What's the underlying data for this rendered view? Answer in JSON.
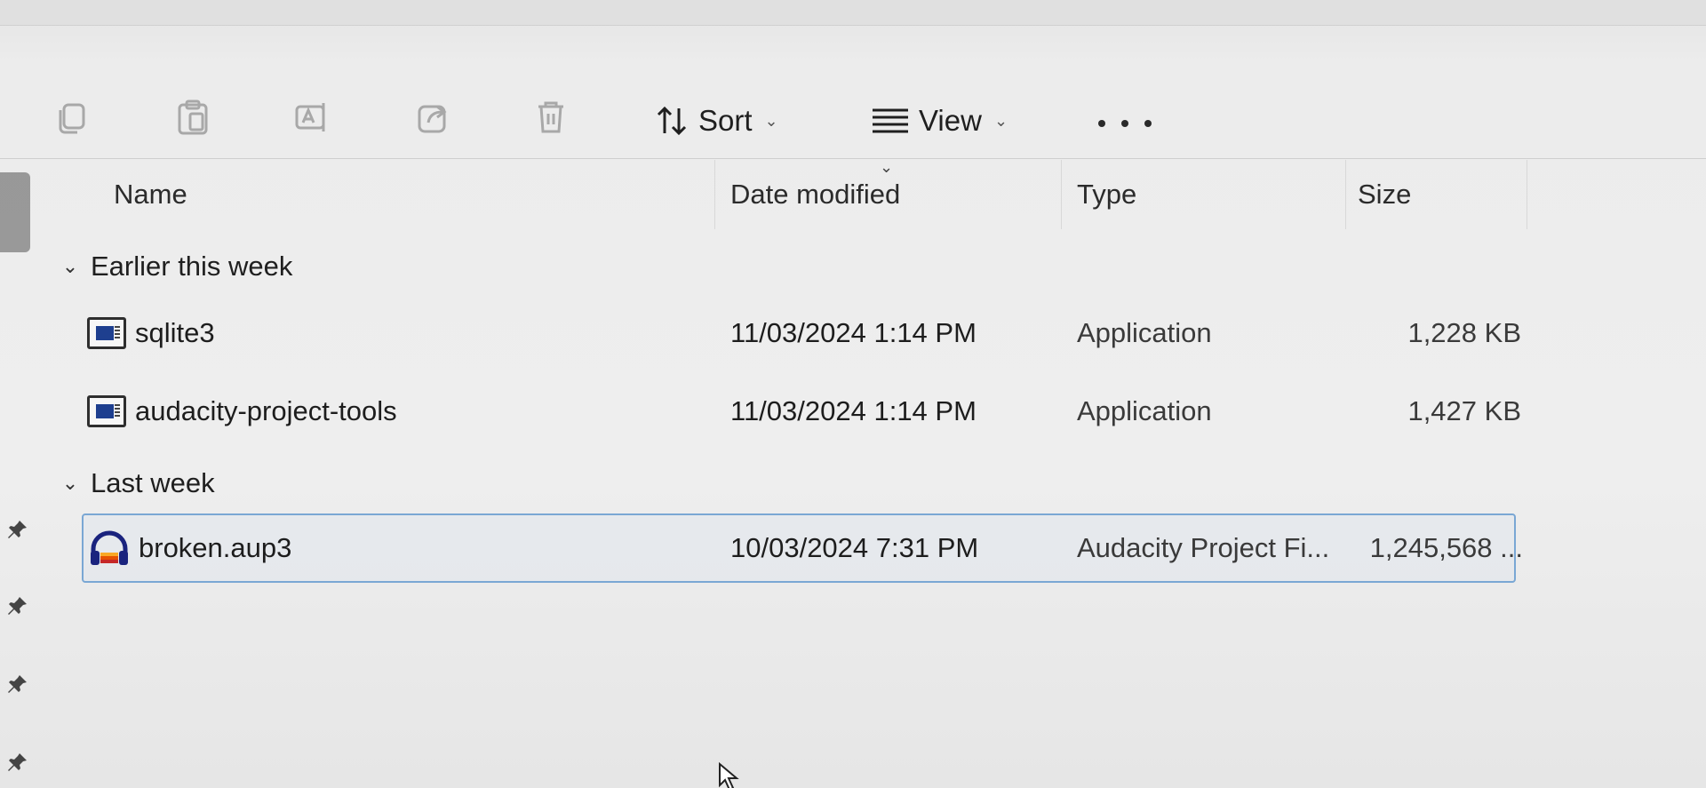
{
  "toolbar": {
    "sort_label": "Sort",
    "view_label": "View"
  },
  "columns": {
    "name": "Name",
    "date_modified": "Date modified",
    "type": "Type",
    "size": "Size"
  },
  "groups": [
    {
      "label": "Earlier this week",
      "files": [
        {
          "name": "sqlite3",
          "date": "11/03/2024 1:14 PM",
          "type": "Application",
          "size": "1,228 KB",
          "icon": "application-icon"
        },
        {
          "name": "audacity-project-tools",
          "date": "11/03/2024 1:14 PM",
          "type": "Application",
          "size": "1,427 KB",
          "icon": "application-icon"
        }
      ]
    },
    {
      "label": "Last week",
      "files": [
        {
          "name": "broken.aup3",
          "date": "10/03/2024 7:31 PM",
          "type": "Audacity Project Fi...",
          "size": "1,245,568 ...",
          "icon": "audacity-icon",
          "selected": true
        }
      ]
    }
  ],
  "colors": {
    "accent": "#7aa7d4",
    "app_icon_blue": "#1e3f8f"
  }
}
